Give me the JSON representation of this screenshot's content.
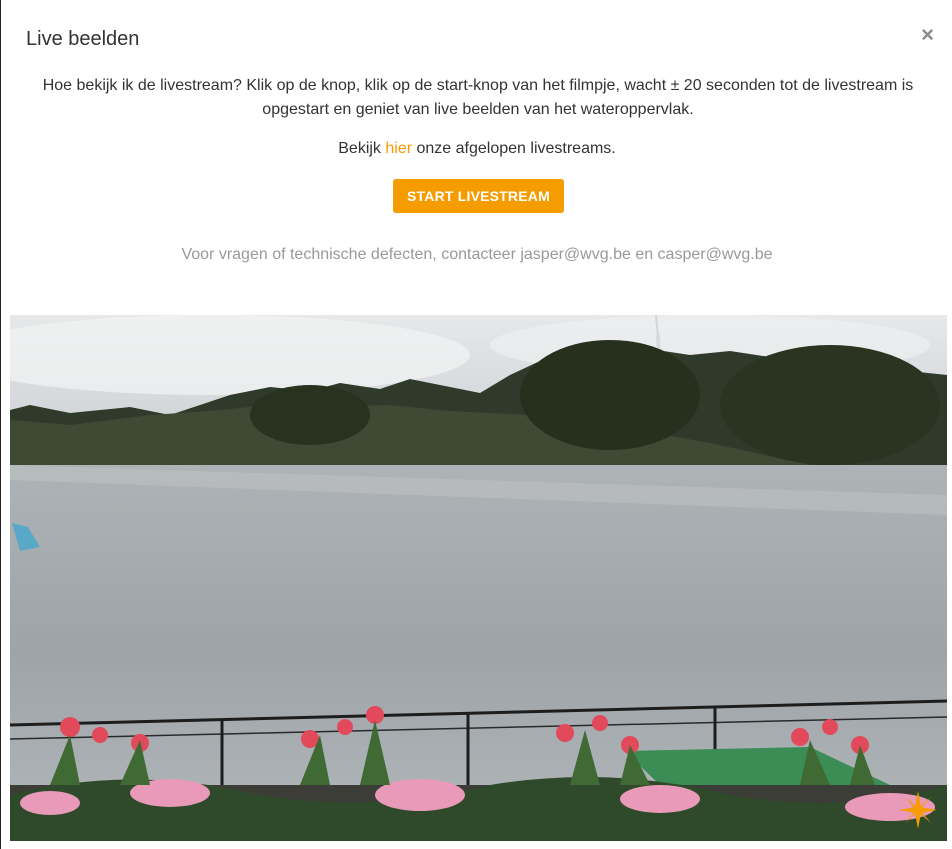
{
  "modal": {
    "title": "Live beelden",
    "close_symbol": "×",
    "intro_text": "Hoe bekijk ik de livestream? Klik op de knop, klik op de start-knop van het filmpje, wacht ± 20 seconden tot de livestream is opgestart en geniet van live beelden van het wateroppervlak.",
    "archive_prefix": "Bekijk ",
    "archive_link": "hier",
    "archive_suffix": " onze afgelopen livestreams.",
    "start_button": "START LIVESTREAM",
    "contact_text": "Voor vragen of technische defecten, contacteer jasper@wvg.be en casper@wvg.be"
  },
  "video": {
    "scene": "lake-view-with-flowers",
    "logo_icon": "compass-star-icon"
  },
  "colors": {
    "accent": "#f59c00",
    "text": "#333333",
    "muted": "#999999"
  }
}
